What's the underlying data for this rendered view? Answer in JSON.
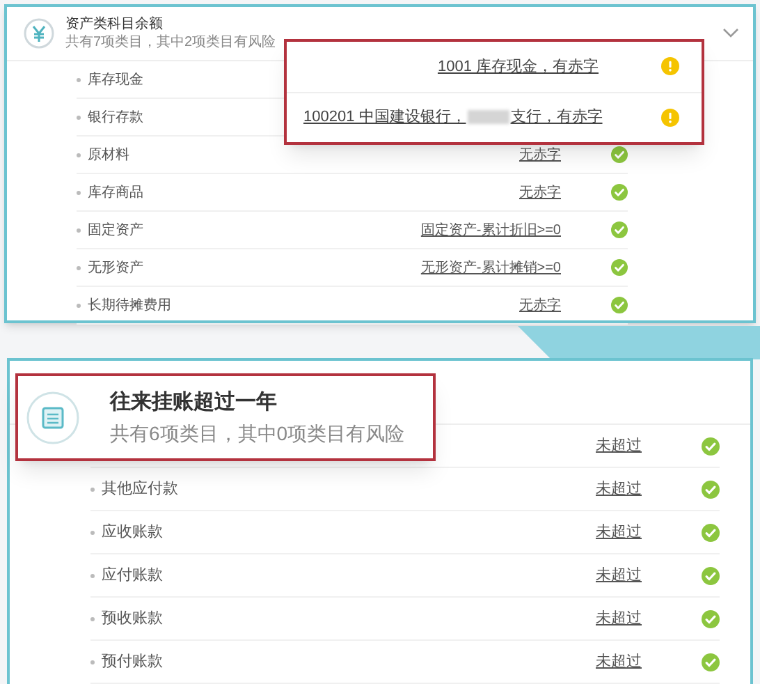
{
  "asset_panel": {
    "title": "资产类科目余额",
    "subtitle": "共有7项类目，其中2项类目有风险",
    "expanded": true,
    "rows": [
      {
        "label": "库存现金"
      },
      {
        "label": "银行存款"
      },
      {
        "label": "原材料",
        "result": "无赤字",
        "risk": false
      },
      {
        "label": "库存商品",
        "result": "无赤字",
        "risk": false
      },
      {
        "label": "固定资产",
        "result": "固定资产-累计折旧>=0",
        "risk": false
      },
      {
        "label": "无形资产",
        "result": "无形资产-累计摊销>=0",
        "risk": false
      },
      {
        "label": "长期待摊费用",
        "result": "无赤字",
        "risk": false
      }
    ],
    "callout": [
      {
        "text": "1001 库存现金，有赤字",
        "risk": true
      },
      {
        "text": "100201 中国建设银行，",
        "text_after": "支行，有赤字",
        "risk": true,
        "redacted": true
      }
    ]
  },
  "aging_panel": {
    "callout": {
      "title": "往来挂账超过一年",
      "subtitle": "共有6项类目，其中0项类目有风险"
    },
    "rows": [
      {
        "result": "未超过",
        "risk": false
      },
      {
        "label": "其他应付款",
        "result": "未超过",
        "risk": false
      },
      {
        "label": "应收账款",
        "result": "未超过",
        "risk": false
      },
      {
        "label": "应付账款",
        "result": "未超过",
        "risk": false
      },
      {
        "label": "预收账款",
        "result": "未超过",
        "risk": false
      },
      {
        "label": "预付账款",
        "result": "未超过",
        "risk": false
      }
    ]
  }
}
